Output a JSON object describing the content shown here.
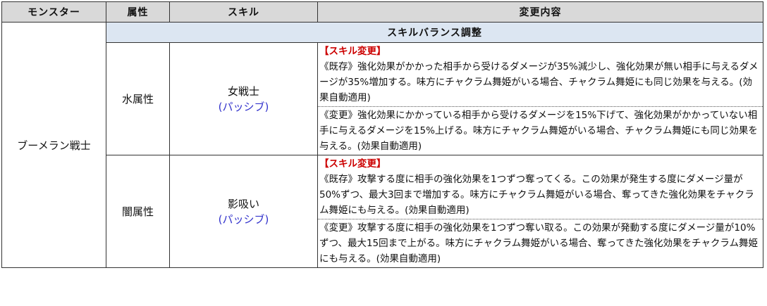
{
  "headers": {
    "monster": "モンスター",
    "attribute": "属性",
    "skill": "スキル",
    "change": "変更内容"
  },
  "section": "スキルバランス調整",
  "monster_name": "ブーメラン戦士",
  "rows": [
    {
      "attribute": "水属性",
      "skill_name": "女戦士",
      "skill_type": "(パッシブ)",
      "tag": "【スキル変更】",
      "before": "《既存》強化効果がかかった相手から受けるダメージが35%減少し、強化効果が無い相手に与えるダメージが35%増加する。味方にチャクラム舞姫がいる場合、チャクラム舞姫にも同じ効果を与える。(効果自動適用)",
      "after": "《変更》強化効果にかかっている相手から受けるダメージを15%下げて、強化効果がかかっていない相手に与えるダメージを15%上げる。味方にチャクラム舞姫がいる場合、チャクラム舞姫にも同じ効果を与える。(効果自動適用)"
    },
    {
      "attribute": "闇属性",
      "skill_name": "影吸い",
      "skill_type": "(パッシブ)",
      "tag": "【スキル変更】",
      "before": "《既存》攻撃する度に相手の強化効果を1つずつ奪ってくる。この効果が発生する度にダメージ量が50%ずつ、最大3回まで増加する。味方にチャクラム舞姫がいる場合、奪ってきた強化効果をチャクラム舞姫にも与える。(効果自動適用)",
      "after": "《変更》攻撃する度に相手の強化効果を1つずつ奪い取る。この効果が発動する度にダメージ量が10%ずつ、最大15回まで上がる。味方にチャクラム舞姫がいる場合、奪ってきた強化効果をチャクラム舞姫にも与える。(効果自動適用)"
    }
  ]
}
